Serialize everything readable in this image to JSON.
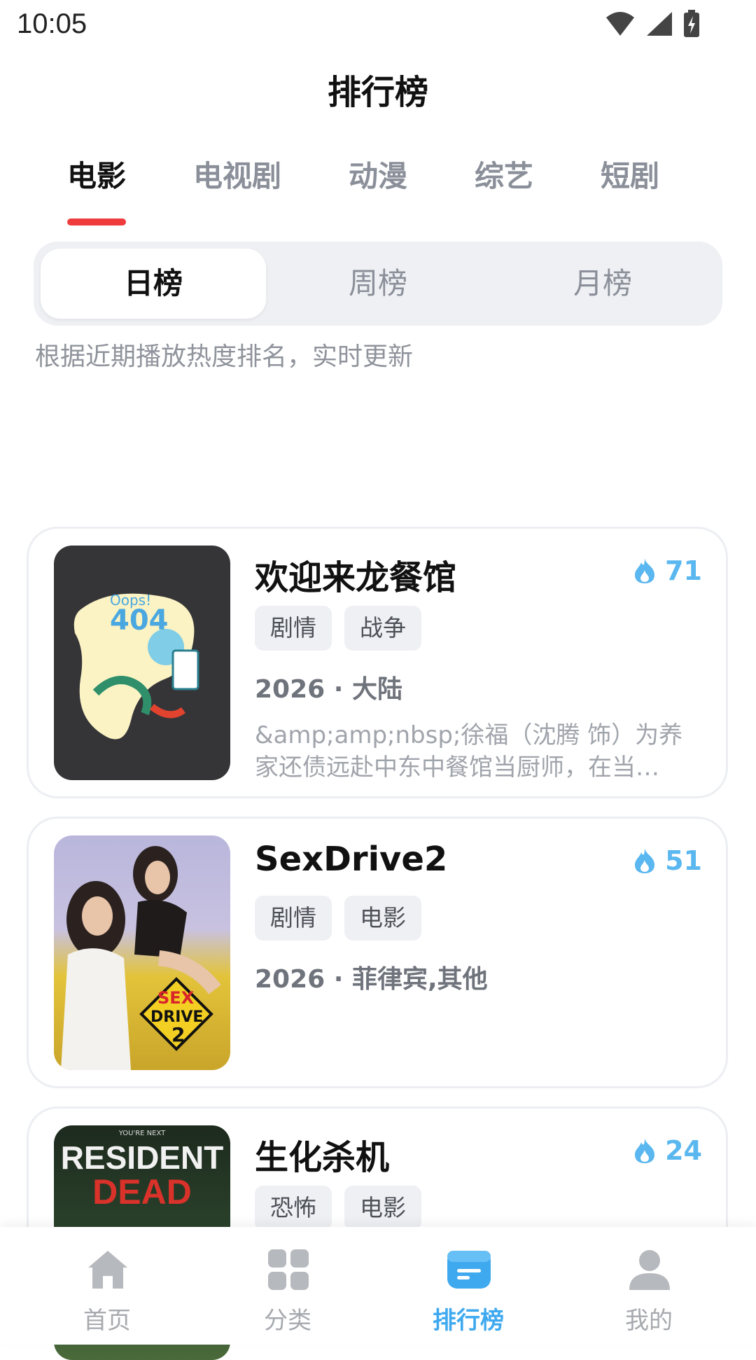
{
  "status_bar": {
    "time": "10:05"
  },
  "header": {
    "title": "排行榜"
  },
  "category_tabs": [
    {
      "label": "电影",
      "active": true
    },
    {
      "label": "电视剧",
      "active": false
    },
    {
      "label": "动漫",
      "active": false
    },
    {
      "label": "综艺",
      "active": false
    },
    {
      "label": "短剧",
      "active": false
    }
  ],
  "period_tabs": [
    {
      "label": "日榜",
      "active": true
    },
    {
      "label": "周榜",
      "active": false
    },
    {
      "label": "月榜",
      "active": false
    }
  ],
  "description": "根据近期播放热度排名，实时更新",
  "rankings": [
    {
      "title": "欢迎来龙餐馆",
      "heat": "71",
      "tags": [
        "剧情",
        "战争"
      ],
      "meta": "2026 · 大陆",
      "synopsis": "&amp;amp;nbsp;徐福（沈腾 饰）为养家还债远赴中东中餐馆当厨师，在当…",
      "poster_text": [
        "Oops!",
        "404"
      ]
    },
    {
      "title": "SexDrive2",
      "heat": "51",
      "tags": [
        "剧情",
        "电影"
      ],
      "meta": "2026 · 菲律宾,其他",
      "synopsis": "",
      "poster_text": [
        "SEX",
        "DRIVE",
        "2"
      ]
    },
    {
      "title": "生化杀机",
      "heat": "24",
      "tags": [
        "恐怖",
        "电影"
      ],
      "meta": "",
      "synopsis": "",
      "poster_text": [
        "YOU'RE NEXT",
        "RESIDENT",
        "DEAD"
      ]
    }
  ],
  "bottom_nav": [
    {
      "label": "首页",
      "icon": "home-icon",
      "active": false
    },
    {
      "label": "分类",
      "icon": "grid-icon",
      "active": false
    },
    {
      "label": "排行榜",
      "icon": "ranking-icon",
      "active": true
    },
    {
      "label": "我的",
      "icon": "user-icon",
      "active": false
    }
  ],
  "colors": {
    "accent": "#3fa9ef",
    "indicator": "#ef3b3b",
    "heat": "#5ab7ef"
  }
}
